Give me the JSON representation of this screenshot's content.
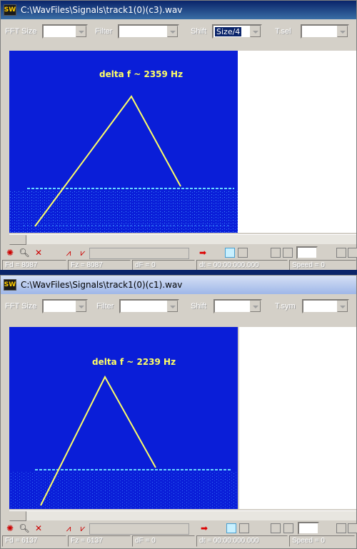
{
  "windows": [
    {
      "title": "C:\\WavFiles\\Signals\\track1(0)(c3).wav",
      "app_icon_text": "SW",
      "toolbar": {
        "fft_label": "FFT Size",
        "filter_label": "Filter",
        "shift_label": "Shift",
        "shift_value": "Size/4",
        "right_label": "T.sel"
      },
      "annotation": "delta f ~ 2359 Hz",
      "status": {
        "fd": "Fd = 8087",
        "fz": "Fz = 8087",
        "df": "dF = 0",
        "dt": "dt = 00:00:000.000",
        "speed": "Speed = 0"
      }
    },
    {
      "title": "C:\\WavFiles\\Signals\\track1(0)(c1).wav",
      "app_icon_text": "SW",
      "toolbar": {
        "fft_label": "FFT Size",
        "filter_label": "Filter",
        "shift_label": "Shift",
        "shift_value": "",
        "right_label": "T.sym"
      },
      "annotation": "delta f ~ 2239 Hz",
      "status": {
        "fd": "Fd = 6137",
        "fz": "Fz = 6137",
        "df": "dF = 0",
        "dt": "dt = 00:00:000.000",
        "speed": "Speed = 0"
      }
    }
  ],
  "colors": {
    "spectrogram_bg": "#0a1ed8",
    "trace_yellow": "#ffff66",
    "title_active": "#0a246a",
    "title_inactive": "#c8d6f2"
  },
  "icons": {
    "snowflake": "snowflake-icon",
    "zoom": "zoom-icon",
    "delete": "delete-icon",
    "chart_up": "chart-up-icon",
    "chart_down": "chart-down-icon",
    "arrow_right": "red-arrow-icon"
  }
}
